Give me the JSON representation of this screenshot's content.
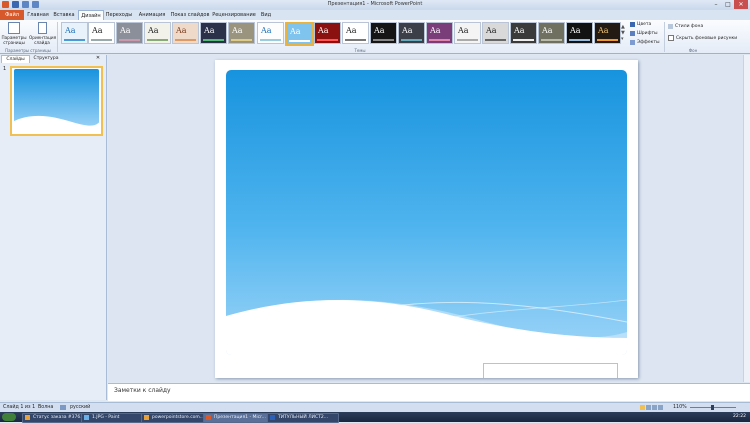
{
  "window": {
    "title": "Презентация1 - Microsoft PowerPoint",
    "min": "–",
    "max": "□",
    "close": "✕"
  },
  "tabs": [
    "Файл",
    "Главная",
    "Вставка",
    "Дизайн",
    "Переходы",
    "Анимация",
    "Показ слайдов",
    "Рецензирование",
    "Вид"
  ],
  "ribbon": {
    "page_setup_label": "Параметры страницы",
    "orientation_label": "Ориентация слайда",
    "page_setup_group": "Параметры страницы",
    "themes_group": "Темы",
    "theme_sample": "Aa",
    "colors": "Цвета",
    "fonts": "Шрифты",
    "effects": "Эффекты",
    "bg_styles": "Стили фона",
    "hide_bg": "Скрыть фоновые рисунки",
    "bg_group": "Фон"
  },
  "left_panel": {
    "tab_slides": "Слайды",
    "tab_outline": "Структура",
    "slide_number": "1"
  },
  "notes": {
    "placeholder": "Заметки к слайду"
  },
  "status": {
    "slide": "Слайд 1 из 1",
    "theme": "Волна",
    "language": "русский",
    "zoom": "110%"
  },
  "taskbar": {
    "items": [
      "Статус заказа #376...",
      "1.JPG - Paint",
      "powerpointstore.com...",
      "Презентация1 - Micr...",
      "ТИТУЛЬНЫЙ ЛИСТ2..."
    ],
    "clock": "22:22"
  },
  "colors": {
    "accent_file": "#d7582a",
    "sky_top": "#1793de",
    "sky_bottom": "#9fd5f8",
    "selected_border": "#f0c052"
  }
}
